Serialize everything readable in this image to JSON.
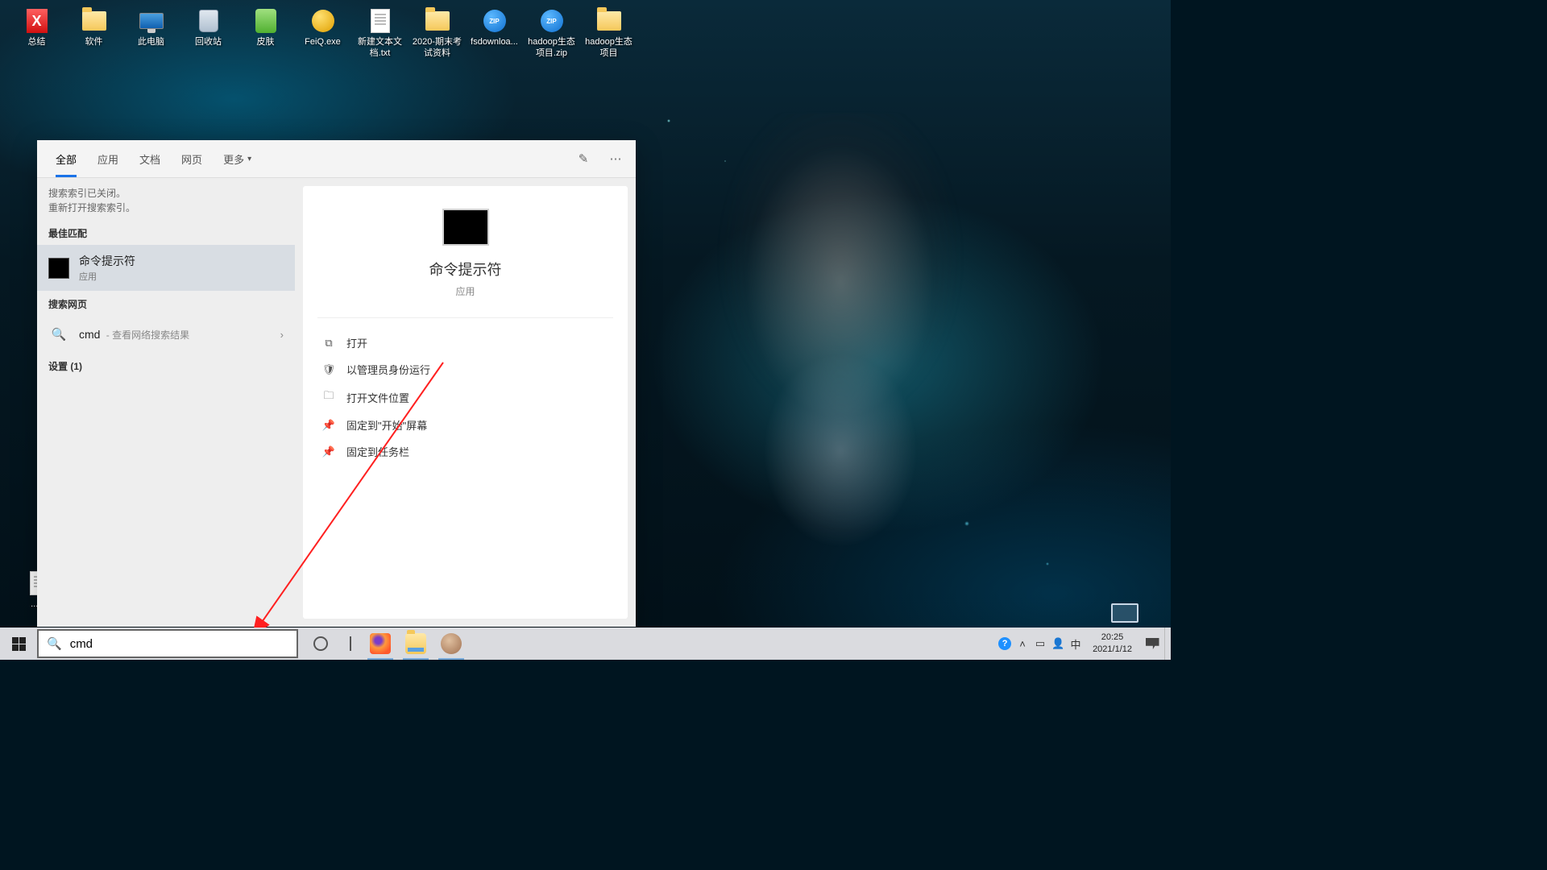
{
  "desktop_icons": [
    {
      "label": "总结",
      "type": "x"
    },
    {
      "label": "软件",
      "type": "folder"
    },
    {
      "label": "此电脑",
      "type": "pc"
    },
    {
      "label": "回收站",
      "type": "bin"
    },
    {
      "label": "皮肤",
      "type": "skin"
    },
    {
      "label": "FeiQ.exe",
      "type": "exe"
    },
    {
      "label": "新建文本文档.txt",
      "type": "txt"
    },
    {
      "label": "2020-期末考试资料",
      "type": "folder"
    },
    {
      "label": "fsdownloa...",
      "type": "zip"
    },
    {
      "label": "hadoop生态项目.zip",
      "type": "zip"
    },
    {
      "label": "hadoop生态项目",
      "type": "folder"
    }
  ],
  "desktop_bottom_icon": {
    "label": "...txt",
    "type": "txt"
  },
  "search": {
    "tabs": {
      "all": "全部",
      "apps": "应用",
      "docs": "文档",
      "web": "网页",
      "more": "更多"
    },
    "notice_l1": "搜索索引已关闭。",
    "notice_l2": "重新打开搜索索引。",
    "best_match": "最佳匹配",
    "result_title": "命令提示符",
    "result_sub": "应用",
    "web_header": "搜索网页",
    "web_item_q": "cmd",
    "web_item_sub": " - 查看网络搜索结果",
    "settings_header": "设置 (1)",
    "card": {
      "title": "命令提示符",
      "sub": "应用",
      "open": "打开",
      "admin": "以管理员身份运行",
      "loc": "打开文件位置",
      "pin_start": "固定到\"开始\"屏幕",
      "pin_task": "固定到任务栏"
    }
  },
  "taskbar": {
    "search_value": "cmd",
    "ime": "中",
    "time": "20:25",
    "date": "2021/1/12"
  }
}
